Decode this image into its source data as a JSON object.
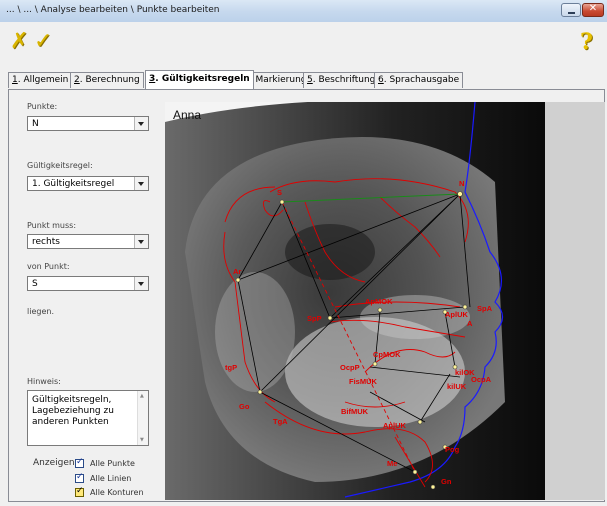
{
  "window": {
    "title": "... \\ ... \\ Analyse bearbeiten \\ Punkte bearbeiten",
    "close_glyph": "✕"
  },
  "toolbar": {
    "cancel_icon": "cancel-x-icon",
    "ok_icon": "checkmark-icon",
    "help_icon": "help-question-icon"
  },
  "tabs": [
    {
      "key": "1",
      "label": ". Allgemein",
      "active": false
    },
    {
      "key": "2",
      "label": ". Berechnung",
      "active": false
    },
    {
      "key": "3",
      "label": ". Gültigkeitsregeln",
      "active": true
    },
    {
      "key": "4",
      "label": ". Markierung",
      "active": false
    },
    {
      "key": "5",
      "label": ". Beschriftung",
      "active": false
    },
    {
      "key": "6",
      "label": ". Sprachausgabe",
      "active": false
    }
  ],
  "form": {
    "punkte_label": "Punkte:",
    "punkte_value": "N",
    "regel_label": "Gültigkeitsregel:",
    "regel_value": "1. Gültigkeitsregel",
    "muss_label": "Punkt muss:",
    "muss_value": "rechts",
    "von_label": "von Punkt:",
    "von_value": "S",
    "liegen_text": "liegen.",
    "hint_label": "Hinweis:",
    "hint_text": "Gültigkeitsregeln,\nLagebeziehung zu\nanderen Punkten"
  },
  "display": {
    "label": "Anzeigen",
    "options": [
      {
        "label": "Alle Punkte",
        "checked": true
      },
      {
        "label": "Alle Linien",
        "checked": true
      },
      {
        "label": "Alle Konturen",
        "checked": true
      }
    ]
  },
  "image": {
    "patient_name": "Anna",
    "landmarks": [
      "S",
      "N",
      "Ar",
      "ApMOK",
      "SpA",
      "SpP",
      "AplUK",
      "A",
      "CpMOK",
      "OcpP",
      "kilOK",
      "FisMUK",
      "OcpA",
      "kilUK",
      "tgP",
      "BifMUK",
      "Go",
      "TgA",
      "AplUK",
      "Pog",
      "Me",
      "Gn"
    ]
  },
  "colors": {
    "landmark": "#e00000",
    "contour_soft": "#1a1aff",
    "contour_bone": "#e00000",
    "sn_line": "#1a8a1a"
  }
}
